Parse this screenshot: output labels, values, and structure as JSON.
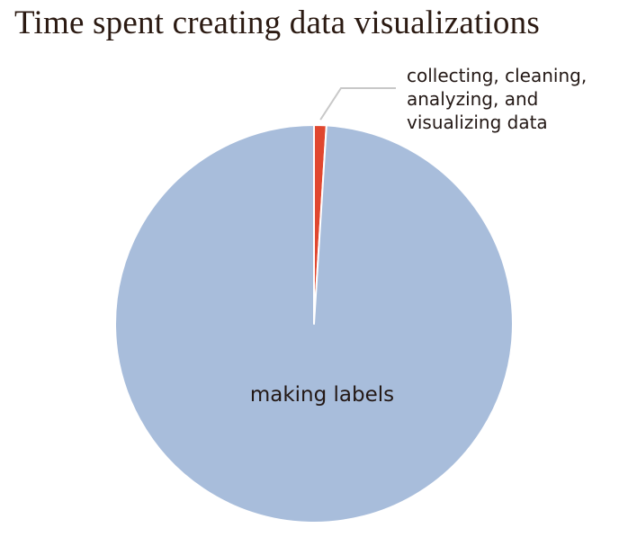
{
  "chart_data": {
    "type": "pie",
    "title": "Time spent creating data visualizations",
    "slices": [
      {
        "label_lines": [
          "collecting, cleaning,",
          "analyzing, and",
          "visualizing data"
        ],
        "value": 1,
        "color": "#e0472f"
      },
      {
        "label_lines": [
          "making labels"
        ],
        "value": 99,
        "color": "#a8bddb"
      }
    ],
    "start_angle": "12 o'clock",
    "direction": "clockwise",
    "slice_separator_color": "#ffffff",
    "leader_line_color": "#c8c8c8",
    "legend": "none"
  }
}
